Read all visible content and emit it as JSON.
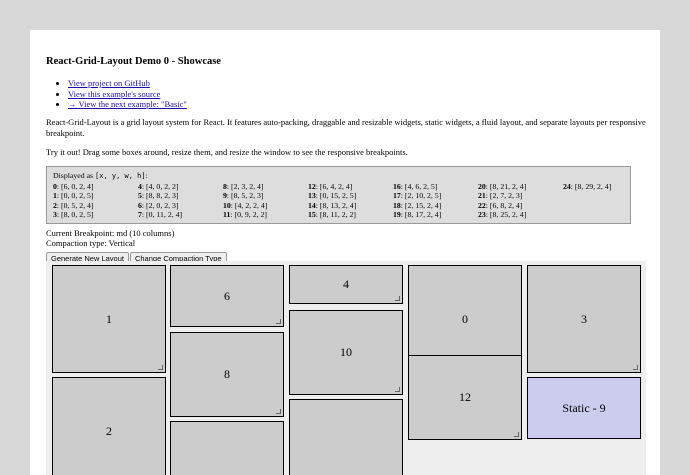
{
  "title": "React-Grid-Layout Demo 0 - Showcase",
  "links": [
    "View project on GitHub",
    "View this example's source",
    "→ View the next example: \"Basic\""
  ],
  "intro": "React-Grid-Layout is a grid layout system for React. It features auto-packing, draggable and resizable widgets, static widgets, a fluid layout, and separate layouts per responsive breakpoint.",
  "try_it": "Try it out! Drag some boxes around, resize them, and resize the window to see the responsive breakpoints.",
  "layout_header_prefix": "Displayed as ",
  "layout_header_code": "[x, y, w, h]",
  "layout_header_suffix": ":",
  "layout_columns": [
    [
      {
        "id": "0",
        "value": "[6, 0, 2, 4]"
      },
      {
        "id": "1",
        "value": "[0, 0, 2, 5]"
      },
      {
        "id": "2",
        "value": "[0, 5, 2, 4]"
      },
      {
        "id": "3",
        "value": "[8, 0, 2, 5]"
      }
    ],
    [
      {
        "id": "4",
        "value": "[4, 0, 2, 2]"
      },
      {
        "id": "5",
        "value": "[8, 8, 2, 3]"
      },
      {
        "id": "6",
        "value": "[2, 0, 2, 3]"
      },
      {
        "id": "7",
        "value": "[0, 11, 2, 4]"
      }
    ],
    [
      {
        "id": "8",
        "value": "[2, 3, 2, 4]"
      },
      {
        "id": "9",
        "value": "[8, 5, 2, 3]"
      },
      {
        "id": "10",
        "value": "[4, 2, 2, 4]"
      },
      {
        "id": "11",
        "value": "[0, 9, 2, 2]"
      }
    ],
    [
      {
        "id": "12",
        "value": "[6, 4, 2, 4]"
      },
      {
        "id": "13",
        "value": "[0, 15, 2, 5]"
      },
      {
        "id": "14",
        "value": "[8, 13, 2, 4]"
      },
      {
        "id": "15",
        "value": "[8, 11, 2, 2]"
      }
    ],
    [
      {
        "id": "16",
        "value": "[4, 6, 2, 5]"
      },
      {
        "id": "17",
        "value": "[2, 10, 2, 5]"
      },
      {
        "id": "18",
        "value": "[2, 15, 2, 4]"
      },
      {
        "id": "19",
        "value": "[8, 17, 2, 4]"
      }
    ],
    [
      {
        "id": "20",
        "value": "[8, 21, 2, 4]"
      },
      {
        "id": "21",
        "value": "[2, 7, 2, 3]"
      },
      {
        "id": "22",
        "value": "[6, 8, 2, 4]"
      },
      {
        "id": "23",
        "value": "[8, 25, 2, 4]"
      }
    ],
    [
      {
        "id": "24",
        "value": "[8, 29, 2, 4]"
      }
    ]
  ],
  "breakpoint_text": "Current Breakpoint: md (10 columns)",
  "compaction_text": "Compaction type: Vertical",
  "buttons": {
    "generate": "Generate New Layout",
    "change_compaction": "Change Compaction Type"
  },
  "grid_items": [
    {
      "label": "1",
      "static": false
    },
    {
      "label": "6",
      "static": false
    },
    {
      "label": "4",
      "static": false
    },
    {
      "label": "0",
      "static": false
    },
    {
      "label": "3",
      "static": false
    },
    {
      "label": "10",
      "static": false
    },
    {
      "label": "8",
      "static": false
    },
    {
      "label": "12",
      "static": false
    },
    {
      "label": "2",
      "static": false
    },
    {
      "label": "Static - 9",
      "static": true
    },
    {
      "label": "",
      "static": false
    },
    {
      "label": "",
      "static": false
    }
  ],
  "colors": {
    "item_bg": "#cccccc",
    "static_bg": "#ccccee",
    "grid_bg": "#eeeeee",
    "link": "#1a0dab"
  }
}
